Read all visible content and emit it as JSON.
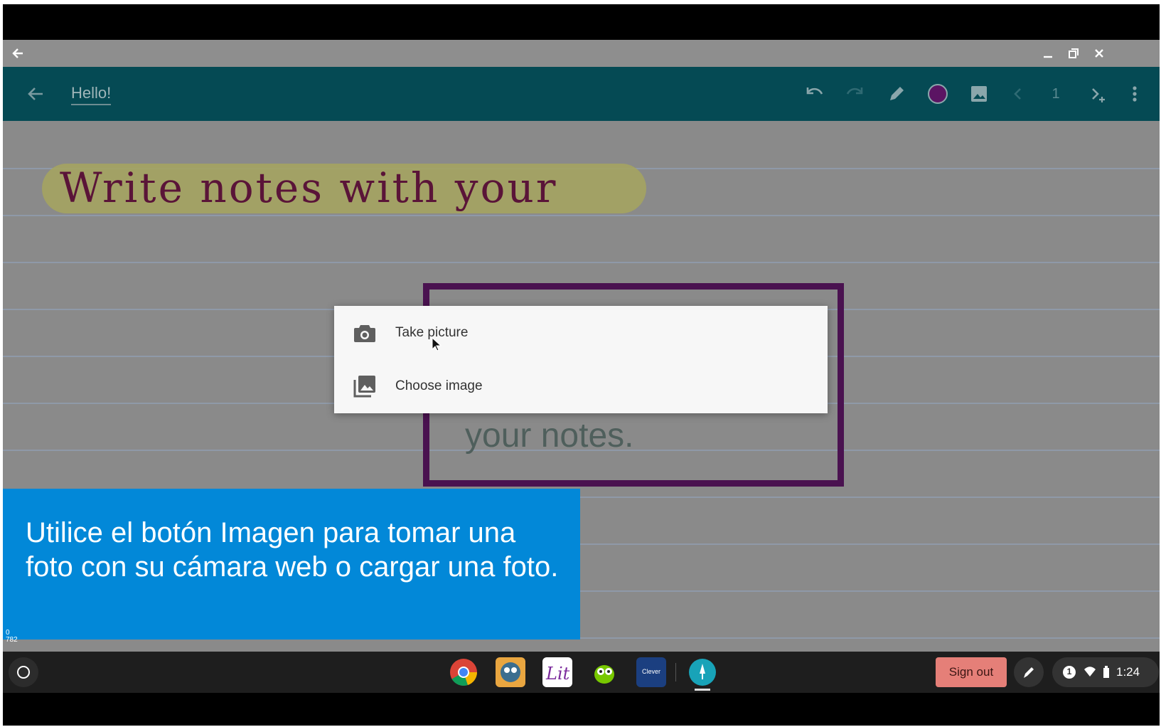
{
  "app_bar": {
    "title": "Hello!",
    "page_number": "1",
    "pen_color": "#5b1463"
  },
  "note_canvas": {
    "handwriting": "Write notes with your",
    "box_text": "your notes."
  },
  "image_menu": {
    "items": [
      {
        "label": "Take picture",
        "icon": "camera-icon"
      },
      {
        "label": "Choose image",
        "icon": "image-icon"
      }
    ]
  },
  "caption": {
    "text": "Utilice el botón Imagen para tomar una foto con su cámara web o cargar una foto."
  },
  "shelf": {
    "apps": [
      "chrome-icon",
      "owl-reader-icon",
      "lit-icon",
      "duolingo-icon",
      "clever-icon",
      "keep-icon"
    ],
    "clever_label": "Clever",
    "sign_out_label": "Sign out",
    "notification_count": "1",
    "time": "1:24"
  },
  "corner_readout": {
    "line1": "0",
    "line2": "782"
  }
}
